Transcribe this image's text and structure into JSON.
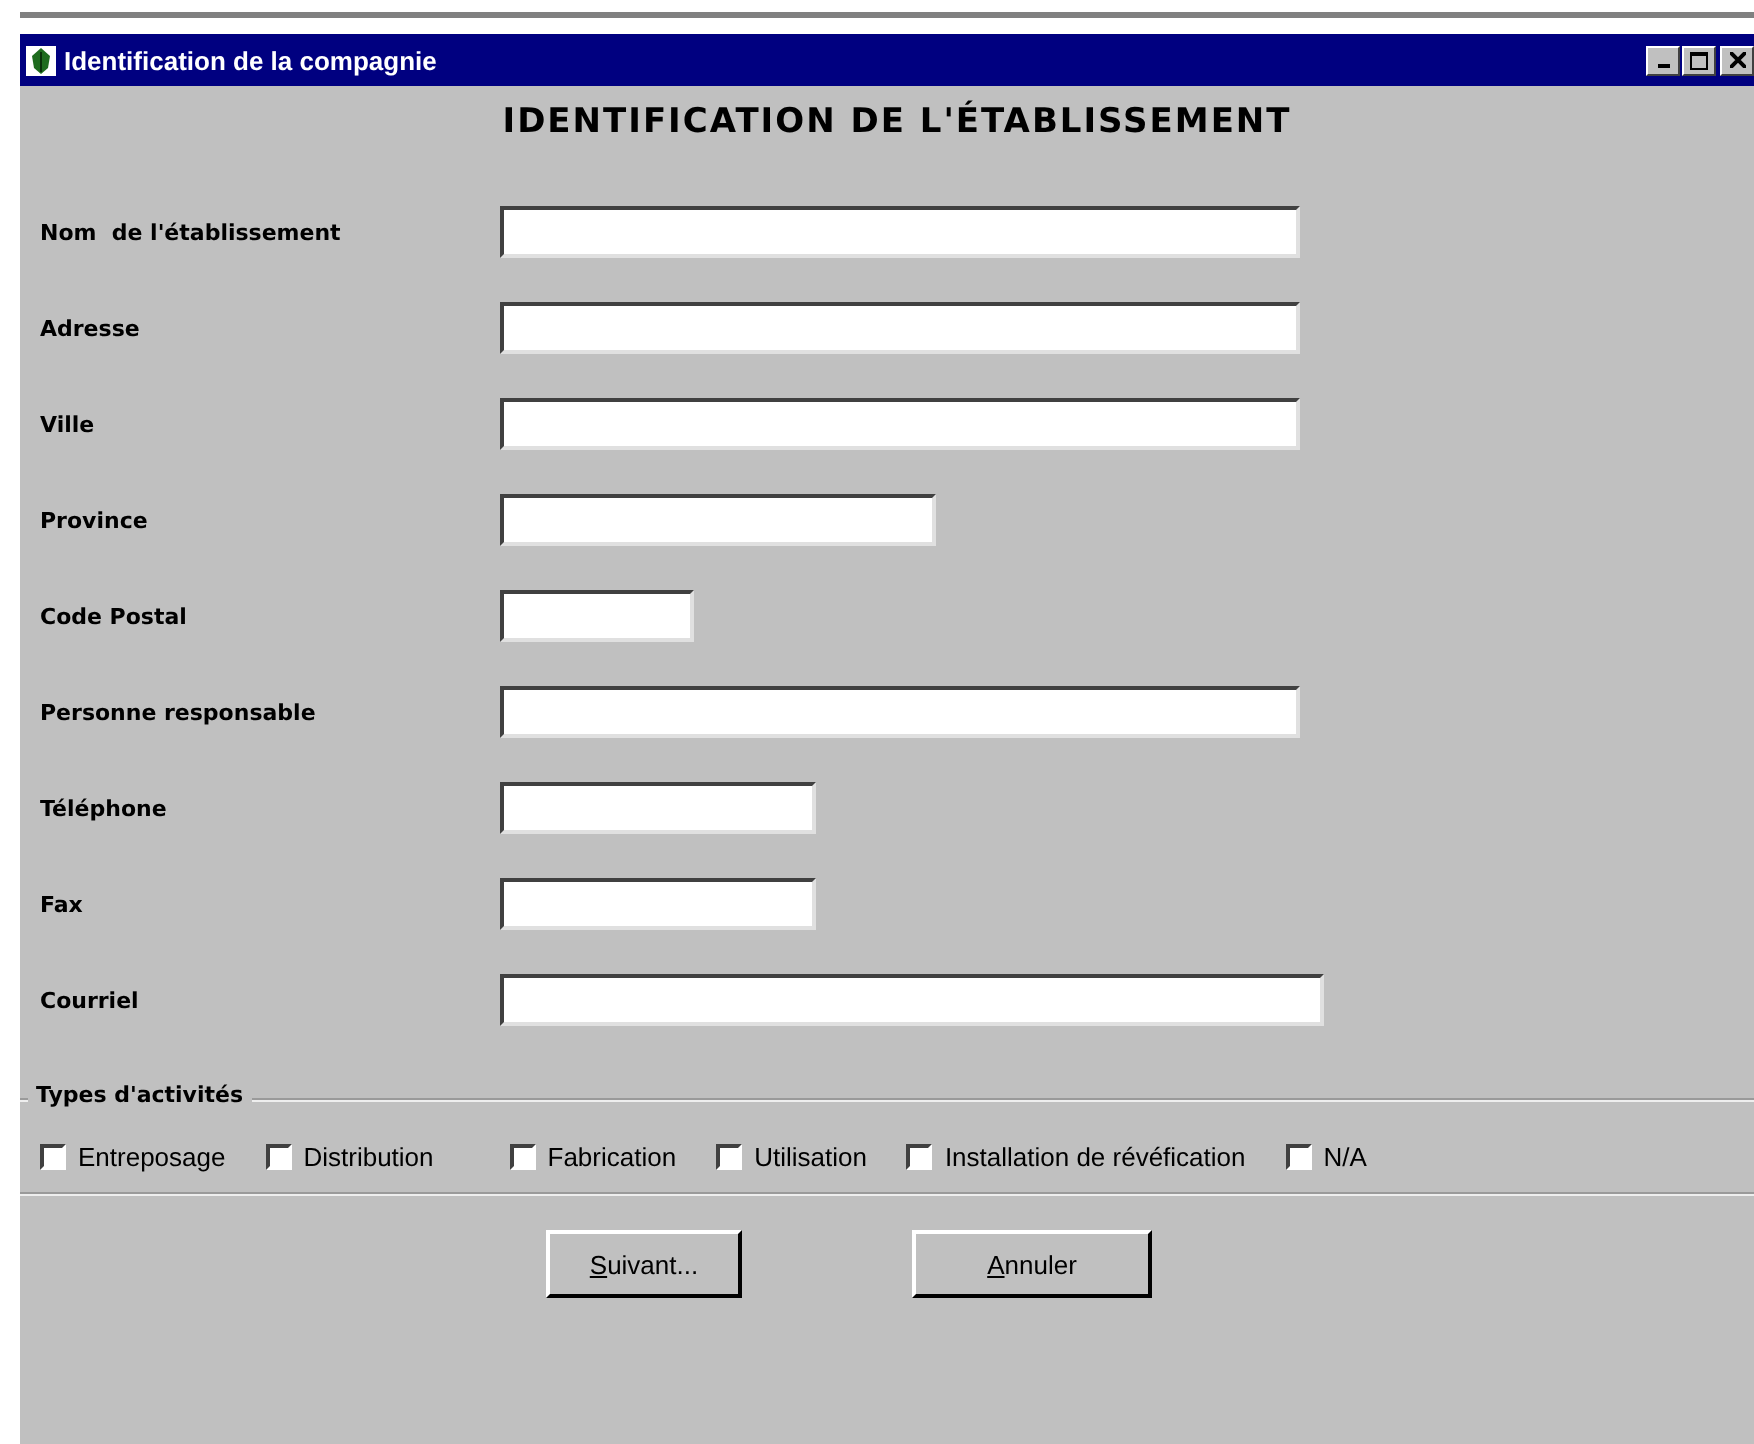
{
  "window": {
    "title": "Identification de la compagnie"
  },
  "heading": "IDENTIFICATION DE L'ÉTABLISSEMENT",
  "fields": [
    {
      "label": "Nom  de l'établissement",
      "kind": "wide"
    },
    {
      "label": "Adresse",
      "kind": "wide"
    },
    {
      "label": "Ville",
      "kind": "wide"
    },
    {
      "label": "Province",
      "kind": "medium"
    },
    {
      "label": "Code Postal",
      "kind": "tiny"
    },
    {
      "label": "Personne responsable",
      "kind": "wide"
    },
    {
      "label": "Téléphone",
      "kind": "short"
    },
    {
      "label": "Fax",
      "kind": "short"
    },
    {
      "label": "Courriel",
      "kind": "xwide"
    }
  ],
  "activities": {
    "title": "Types d'activités",
    "options": [
      {
        "label": "Entreposage",
        "checked": false
      },
      {
        "label": "Distribution",
        "checked": false
      },
      {
        "label": "Fabrication",
        "checked": false
      },
      {
        "label": "Utilisation",
        "checked": false
      },
      {
        "label": "Installation de révéfication",
        "checked": false
      },
      {
        "label": "N/A",
        "checked": false
      }
    ]
  },
  "buttons": [
    "Suivant...",
    "Annuler"
  ]
}
